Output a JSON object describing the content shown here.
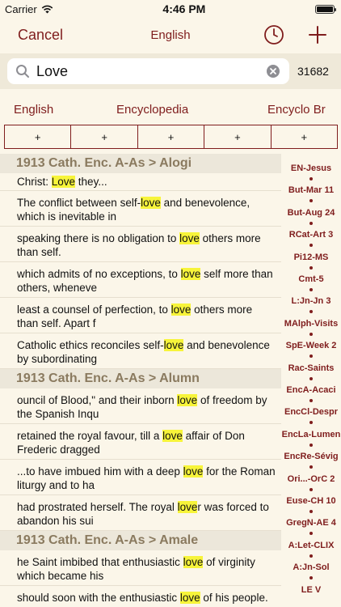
{
  "status": {
    "carrier": "Carrier",
    "time": "4:46 PM"
  },
  "nav": {
    "cancel": "Cancel",
    "title": "English"
  },
  "search": {
    "value": "Love",
    "count": "31682"
  },
  "filters": [
    "English",
    "Encyclopedia",
    "Encyclo Br"
  ],
  "slots": [
    "+",
    "+",
    "+",
    "+",
    "+"
  ],
  "sections": [
    {
      "title": "1913 Cath. Enc. A-As > Alogi",
      "rows": [
        {
          "pre": "Christ: ",
          "match": "Love",
          "post": " they..."
        },
        {
          "pre": "The conflict between self-",
          "match": "love",
          "post": " and benevolence, which is inevitable in"
        },
        {
          "pre": "speaking there is no obligation to ",
          "match": "love",
          "post": " others more than self."
        },
        {
          "pre": " which admits of no exceptions, to ",
          "match": "love",
          "post": " self more than others, wheneve"
        },
        {
          "pre": " least a counsel of perfection, to ",
          "match": "love",
          "post": " others more than self. Apart f"
        },
        {
          "pre": "Catholic ethics reconciles self-",
          "match": "love",
          "post": " and benevolence by subordinating"
        }
      ]
    },
    {
      "title": "1913 Cath. Enc. A-As > Alumn",
      "rows": [
        {
          "pre": "ouncil of Blood,\" and their inborn ",
          "match": "love",
          "post": " of freedom by the Spanish Inqu"
        },
        {
          "pre": " retained the royal favour, till a ",
          "match": "love",
          "post": " affair of Don Frederic dragged"
        },
        {
          "pre": "...to have imbued him with a deep ",
          "match": "love",
          "post": " for the Roman liturgy and to ha"
        },
        {
          "pre": " had prostrated herself. The royal ",
          "match": "love",
          "post": "r was forced to abandon his sui"
        }
      ]
    },
    {
      "title": "1913 Cath. Enc. A-As > Amale",
      "rows": [
        {
          "pre": "he Saint imbibed that enthusiastic ",
          "match": "love",
          "post": " of virginity which became his"
        },
        {
          "pre": " should soon with the enthusiastic ",
          "match": "love",
          "post": " of his people. Rarely, if ever"
        }
      ]
    }
  ],
  "index": [
    "EN-Jesus",
    "But-Mar 11",
    "But-Aug 24",
    "RCat-Art 3",
    "Pi12-MS",
    "Cmt-5",
    "L:Jn-Jn 3",
    "MAlph-Visits",
    "SpE-Week 2",
    "Rac-Saints",
    "EncA-Acaci",
    "EncCl-Despr",
    "EncLa-Lumen",
    "EncRe-Sévig",
    "Ori...-OrC 2",
    "Euse-CH 10",
    "GregN-AE 4",
    "A:Let-CLIX",
    "A:Jn-Sol",
    "LE V"
  ],
  "colors": {
    "accent": "#7f1d1d",
    "highlight": "#f7f43a",
    "background": "#fbf6e9",
    "section": "#ece7da"
  }
}
